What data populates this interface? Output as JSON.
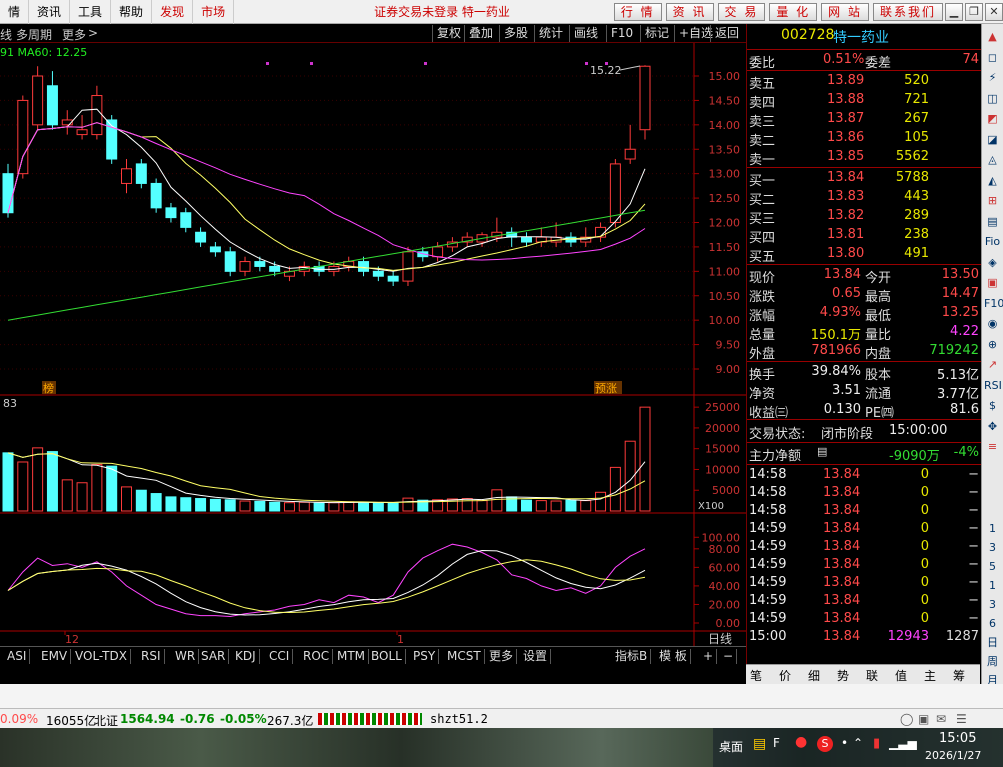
{
  "menu": {
    "items": [
      "情",
      "资讯",
      "工具",
      "帮助"
    ],
    "red_items": [
      "发现",
      "市场"
    ],
    "title": "证券交易未登录 特一药业",
    "buttons": [
      "行 情",
      "资 讯",
      "交 易",
      "量 化",
      "网 站",
      "联系我们"
    ]
  },
  "chart_toolbar": {
    "left_text": "线",
    "multi_period": "多周期",
    "more": "更多",
    "ma_label": "91 MA60: 12.25",
    "buttons": [
      "复权",
      "叠加",
      "多股",
      "统计",
      "画线",
      "F10",
      "标记",
      "+自选",
      "返回"
    ]
  },
  "price_chart": {
    "y_ticks": [
      "15.00",
      "14.50",
      "14.00",
      "13.50",
      "13.00",
      "12.50",
      "12.00",
      "11.50",
      "11.00",
      "10.50",
      "10.00",
      "9.50",
      "9.00"
    ],
    "max_label": "15.22",
    "tags": [
      "榜",
      "预涨"
    ]
  },
  "volume_chart": {
    "label": "83",
    "y_ticks": [
      "25000",
      "20000",
      "15000",
      "10000",
      "5000"
    ],
    "unit": "X100"
  },
  "rsi_chart": {
    "y_ticks": [
      "100.00",
      "80.00",
      "60.00",
      "40.00",
      "20.00",
      "0.00"
    ]
  },
  "x_axis": {
    "labels": [
      "12",
      "1"
    ],
    "period": "日线"
  },
  "chart_data": {
    "type": "candlestick",
    "title": "",
    "visible_candles": 37,
    "price_range": [
      9.0,
      15.22
    ],
    "close_last": 13.84,
    "ma60": 12.25,
    "volume_range": [
      0,
      25000
    ]
  },
  "bottom_tabs": [
    "ASI",
    "EMV",
    "VOL-TDX",
    "RSI",
    "WR",
    "SAR",
    "KDJ",
    "CCI",
    "ROC",
    "MTM",
    "BOLL",
    "PSY",
    "MCST",
    "更多",
    "设置"
  ],
  "bottom_right": [
    "指标B",
    "模 板",
    "+",
    "−"
  ],
  "stock": {
    "code": "002728",
    "name": "特一药业",
    "weibi_label": "委比",
    "weibi": "0.51%",
    "weicha_label": "委差",
    "weicha": "74",
    "asks": [
      {
        "label": "卖五",
        "price": "13.89",
        "vol": "520"
      },
      {
        "label": "卖四",
        "price": "13.88",
        "vol": "721"
      },
      {
        "label": "卖三",
        "price": "13.87",
        "vol": "267"
      },
      {
        "label": "卖二",
        "price": "13.86",
        "vol": "105"
      },
      {
        "label": "卖一",
        "price": "13.85",
        "vol": "5562"
      }
    ],
    "bids": [
      {
        "label": "买一",
        "price": "13.84",
        "vol": "5788"
      },
      {
        "label": "买二",
        "price": "13.83",
        "vol": "443"
      },
      {
        "label": "买三",
        "price": "13.82",
        "vol": "289"
      },
      {
        "label": "买四",
        "price": "13.81",
        "vol": "238"
      },
      {
        "label": "买五",
        "price": "13.80",
        "vol": "491"
      }
    ],
    "stats": [
      {
        "l1": "现价",
        "v1": "13.84",
        "l2": "今开",
        "v2": "13.50"
      },
      {
        "l1": "涨跌",
        "v1": "0.65",
        "l2": "最高",
        "v2": "14.47"
      },
      {
        "l1": "涨幅",
        "v1": "4.93%",
        "l2": "最低",
        "v2": "13.25"
      },
      {
        "l1": "总量",
        "v1": "150.1万",
        "l2": "量比",
        "v2": "4.22"
      },
      {
        "l1": "外盘",
        "v1": "781966",
        "l2": "内盘",
        "v2": "719242"
      }
    ],
    "stats2": [
      {
        "l1": "换手",
        "v1": "39.84%",
        "l2": "股本",
        "v2": "5.13亿"
      },
      {
        "l1": "净资",
        "v1": "3.51",
        "l2": "流通",
        "v2": "3.77亿"
      },
      {
        "l1": "收益㈢",
        "v1": "0.130",
        "l2": "PE㈣",
        "v2": "81.6"
      }
    ],
    "trade_status_label": "交易状态:",
    "trade_status": "闭市阶段",
    "trade_time": "15:00:00",
    "main_flow_label": "主力净额",
    "main_flow": "-9090万",
    "main_flow_pct": "-4%",
    "ticks": [
      {
        "t": "14:58",
        "p": "13.84",
        "v": "0",
        "f": "−"
      },
      {
        "t": "14:58",
        "p": "13.84",
        "v": "0",
        "f": "−"
      },
      {
        "t": "14:58",
        "p": "13.84",
        "v": "0",
        "f": "−"
      },
      {
        "t": "14:59",
        "p": "13.84",
        "v": "0",
        "f": "−"
      },
      {
        "t": "14:59",
        "p": "13.84",
        "v": "0",
        "f": "−"
      },
      {
        "t": "14:59",
        "p": "13.84",
        "v": "0",
        "f": "−"
      },
      {
        "t": "14:59",
        "p": "13.84",
        "v": "0",
        "f": "−"
      },
      {
        "t": "14:59",
        "p": "13.84",
        "v": "0",
        "f": "−"
      },
      {
        "t": "14:59",
        "p": "13.84",
        "v": "0",
        "f": "−"
      },
      {
        "t": "15:00",
        "p": "13.84",
        "v": "12943",
        "f": "1287"
      }
    ]
  },
  "right_tabs": [
    "笔",
    "价",
    "细",
    "势",
    "联",
    "值",
    "主",
    "筹"
  ],
  "sidebar": {
    "text_items": [
      "1",
      "3",
      "5",
      "1",
      "3",
      "6",
      "日",
      "周",
      "月"
    ]
  },
  "status": {
    "pct1": "0.09%",
    "amt1": "16055亿",
    "idx": "北证",
    "idx_val": "1564.94",
    "chg": "-0.76",
    "chg_pct": "-0.05%",
    "amt2": "267.3亿",
    "sh": "shzt51.2"
  },
  "taskbar": {
    "desktop": "桌面",
    "time": "15:05",
    "date": "2026/1/27"
  }
}
